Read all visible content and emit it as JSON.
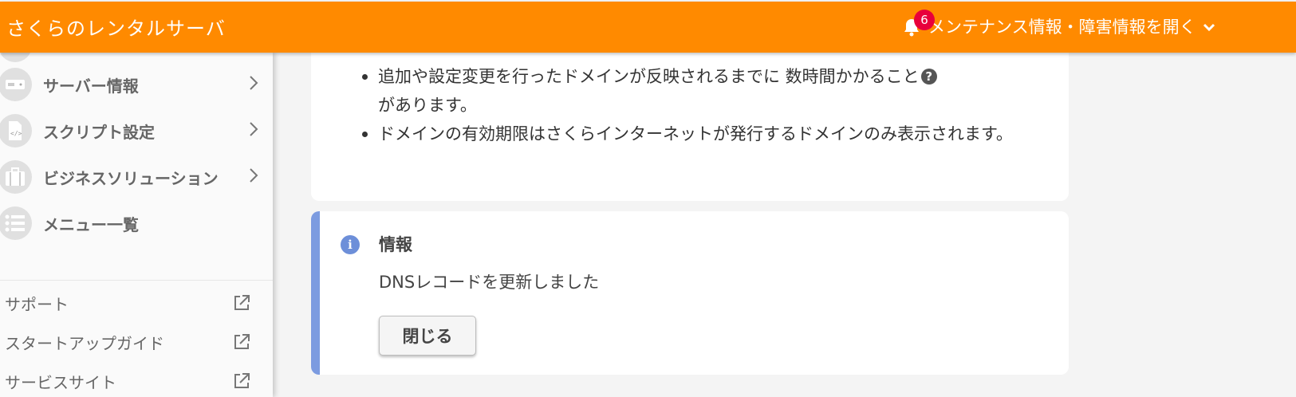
{
  "header": {
    "brand": "さくらのレンタルサーバ",
    "notification_count": "6",
    "notice_label": "メンテナンス情報・障害情報を開く",
    "color": "#ff8a00"
  },
  "sidebar": {
    "nav_items": [
      {
        "label": "サーバー情報",
        "icon": "server-icon"
      },
      {
        "label": "スクリプト設定",
        "icon": "script-file-icon"
      },
      {
        "label": "ビジネスソリューション",
        "icon": "briefcase-icon"
      },
      {
        "label": "メニュー一覧",
        "icon": "list-icon"
      }
    ],
    "external_links": [
      {
        "label": "サポート",
        "icon": "external-link-icon"
      },
      {
        "label": "スタートアップガイド",
        "icon": "external-link-icon"
      },
      {
        "label": "サービスサイト",
        "icon": "external-link-icon"
      }
    ]
  },
  "notes": {
    "item1_text": "追加や設定変更を行ったドメインが反映されるまでに 数時間かかること",
    "item1_tail": "があります。",
    "item2": "ドメインの有効期限はさくらインターネットが発行するドメインのみ表示されます。"
  },
  "info": {
    "title": "情報",
    "message": "DNSレコードを更新しました",
    "close_label": "閉じる",
    "accent": "#7c9be0"
  }
}
